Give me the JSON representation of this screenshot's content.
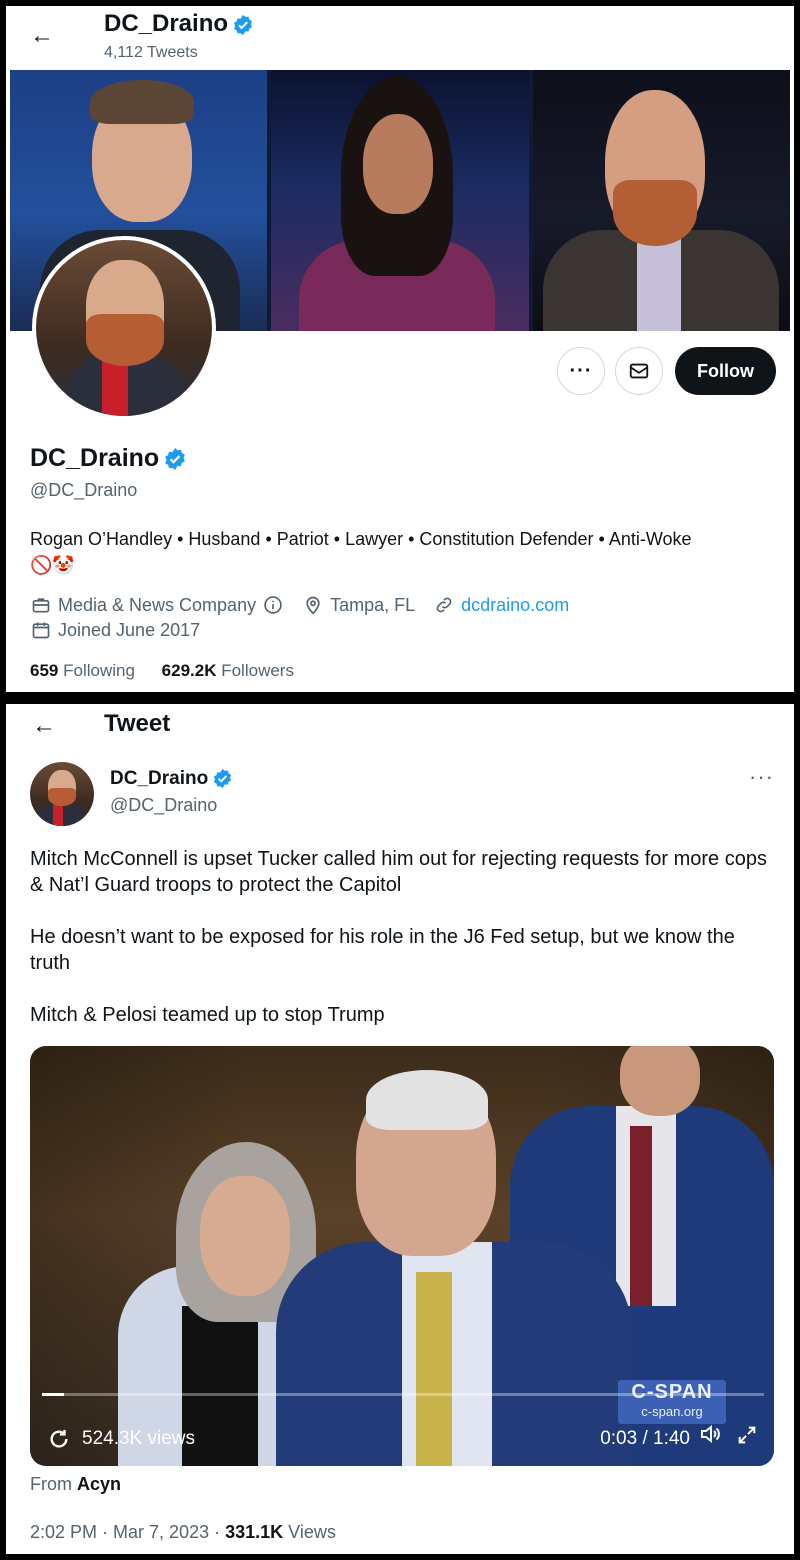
{
  "profile": {
    "top_name": "DC_Draino",
    "tweet_count": "4,112 Tweets",
    "name": "DC_Draino",
    "handle": "@DC_Draino",
    "bio": "Rogan O’Handley • Husband • Patriot • Lawyer • Constitution Defender • Anti-Woke",
    "bio_emoji": "🚫🤡",
    "category": "Media & News Company",
    "location": "Tampa, FL",
    "website": "dcdraino.com",
    "joined": "Joined June 2017",
    "following_count": "659",
    "following_label": "Following",
    "followers_count": "629.2K",
    "followers_label": "Followers",
    "more_icon": "···",
    "follow_label": "Follow"
  },
  "tweet": {
    "title": "Tweet",
    "author_name": "DC_Draino",
    "author_handle": "@DC_Draino",
    "paragraphs": [
      "Mitch McConnell is upset Tucker called him out for rejecting requests for more cops & Nat’l Guard troops to protect the Capitol",
      "He doesn’t want to be exposed for his role in the J6 Fed setup, but we know the truth",
      "Mitch & Pelosi teamed up to stop Trump"
    ],
    "video": {
      "views": "524.3K views",
      "time": "0:03 / 1:40",
      "progress": 0.03,
      "watermark_big": "C-SPAN",
      "watermark_small": "c-span.org"
    },
    "from_prefix": "From",
    "from_source": "Acyn",
    "date": "2:02 PM · Mar 7, 2023 ·",
    "view_count": "331.1K",
    "view_label": "Views"
  },
  "colors": {
    "accent": "#1d9bf0",
    "text": "#0f1419",
    "muted": "#536471"
  }
}
